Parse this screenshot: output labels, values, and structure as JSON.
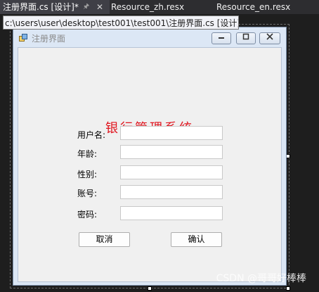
{
  "tabs": [
    {
      "label": "注册界面.cs [设计]*",
      "active": true
    },
    {
      "label": "Resource_zh.resx",
      "active": false
    },
    {
      "label": "Resource_en.resx",
      "active": false
    }
  ],
  "tab_icons": {
    "pin": "pin-icon",
    "close": "close-icon"
  },
  "tooltip": "c:\\users\\user\\desktop\\test001\\test001\\注册界面.cs [设计]*",
  "form": {
    "title": "注册界面",
    "heading": "银行管理系统",
    "heading_color": "#e0141e",
    "fields": [
      {
        "label": "用户名:",
        "value": ""
      },
      {
        "label": "年龄:",
        "value": ""
      },
      {
        "label": "性别:",
        "value": ""
      },
      {
        "label": "账号:",
        "value": ""
      },
      {
        "label": "密码:",
        "value": ""
      }
    ],
    "buttons": {
      "cancel": "取消",
      "confirm": "确认"
    }
  },
  "watermark": "CSDN @哥哥好棒棒"
}
